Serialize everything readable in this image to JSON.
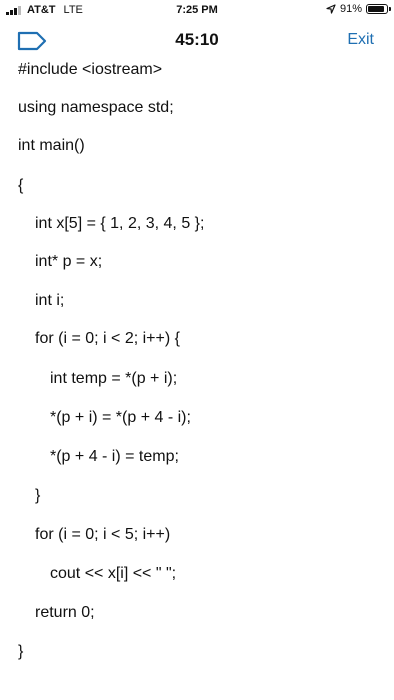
{
  "status": {
    "carrier": "AT&T",
    "network": "LTE",
    "time": "7:25 PM",
    "battery_percent": "91%",
    "battery_level": 0.91,
    "signal_bars": 3
  },
  "nav": {
    "tag_icon": "tag-outline-icon",
    "timer": "45:10",
    "exit_label": "Exit",
    "accent_color": "#1f6fb2"
  },
  "code": {
    "lines": [
      "#include <iostream>",
      "using namespace std;",
      "int main()",
      "{",
      "int x[5] = { 1, 2, 3, 4, 5 };",
      "int* p = x;",
      "int i;",
      "for (i = 0; i < 2; i++) {",
      "int temp = *(p + i);",
      "*(p + i) = *(p + 4 - i);",
      "*(p + 4 - i) = temp;",
      "}",
      "for (i = 0; i < 5; i++)",
      "cout << x[i] << \" \";",
      "return 0;",
      "}"
    ]
  }
}
